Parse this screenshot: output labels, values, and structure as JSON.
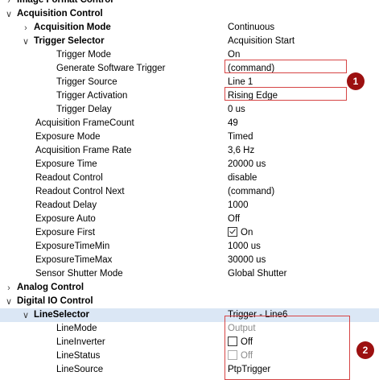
{
  "rows": [
    {
      "label": "Image Format Control",
      "value": "",
      "bold": true,
      "expander": "closed"
    },
    {
      "label": "Acquisition Control",
      "value": "",
      "bold": true,
      "expander": "open"
    },
    {
      "label": "Acquisition Mode",
      "value": "Continuous",
      "bold": true,
      "expander": "closed"
    },
    {
      "label": "Trigger Selector",
      "value": "Acquisition Start",
      "bold": true,
      "expander": "open"
    },
    {
      "label": "Trigger Mode",
      "value": "On"
    },
    {
      "label": "Generate Software Trigger",
      "value": "(command)"
    },
    {
      "label": "Trigger Source",
      "value": "Line 1"
    },
    {
      "label": "Trigger Activation",
      "value": "Rising Edge"
    },
    {
      "label": "Trigger Delay",
      "value": "0 us"
    },
    {
      "label": "Acquisition FrameCount",
      "value": "49"
    },
    {
      "label": "Exposure Mode",
      "value": "Timed"
    },
    {
      "label": "Acquisition Frame Rate",
      "value": "3,6 Hz"
    },
    {
      "label": "Exposure Time",
      "value": "20000 us"
    },
    {
      "label": "Readout Control",
      "value": "disable"
    },
    {
      "label": "Readout Control Next",
      "value": "(command)"
    },
    {
      "label": "Readout Delay",
      "value": "1000"
    },
    {
      "label": "Exposure Auto",
      "value": "Off"
    },
    {
      "label": "Exposure First",
      "value": "On",
      "checkbox": true,
      "checked": true
    },
    {
      "label": "ExposureTimeMin",
      "value": "1000 us"
    },
    {
      "label": "ExposureTimeMax",
      "value": "30000 us"
    },
    {
      "label": "Sensor Shutter Mode",
      "value": "Global Shutter"
    },
    {
      "label": "Analog Control",
      "value": "",
      "bold": true,
      "expander": "closed"
    },
    {
      "label": "Digital IO Control",
      "value": "",
      "bold": true,
      "expander": "open"
    },
    {
      "label": "LineSelector",
      "value": "Trigger - Line6",
      "bold": true,
      "expander": "open",
      "selected": true
    },
    {
      "label": "LineMode",
      "value": "Output",
      "disabled": true
    },
    {
      "label": "LineInverter",
      "value": "Off",
      "checkbox": true,
      "checked": false
    },
    {
      "label": "LineStatus",
      "value": "Off",
      "checkbox": true,
      "checked": false,
      "disabled": true
    },
    {
      "label": "LineSource",
      "value": "PtpTrigger"
    }
  ],
  "annotations": [
    {
      "number": "1"
    },
    {
      "number": "2"
    }
  ],
  "colors": {
    "highlight_border": "#d64545",
    "badge": "#9c1010",
    "selected_row": "#dbe7f5"
  }
}
